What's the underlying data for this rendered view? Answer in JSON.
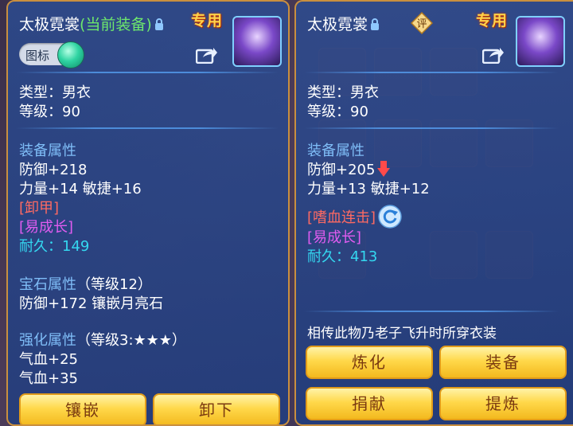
{
  "left": {
    "title": "太极霓裳",
    "equipped_tag": "(当前装备)",
    "exclusive": "专用",
    "toggle_label": "图标",
    "type_line": "类型：男衣",
    "level_line": "等级：90",
    "equip_attr_header": "装备属性",
    "defense": "防御+218",
    "stats": "力量+14 敏捷+16",
    "special_1": "[卸甲]",
    "special_2": "[易成长]",
    "durability_label": "耐久：",
    "durability_value": "149",
    "gem_header": "宝石属性",
    "gem_level": "（等级12）",
    "gem_line": "防御+172 镶嵌月亮石",
    "enhance_header": "强化属性",
    "enhance_level": "（等级3:★★★）",
    "enhance_1": "气血+25",
    "enhance_2": "气血+35",
    "buttons": {
      "inlay": "镶嵌",
      "unequip": "卸下"
    }
  },
  "right": {
    "title": "太极霓裳",
    "exclusive": "专用",
    "seal_char": "评",
    "type_line": "类型：男衣",
    "level_line": "等级：90",
    "equip_attr_header": "装备属性",
    "defense": "防御+205",
    "stats": "力量+13 敏捷+12",
    "special_1": "[嗜血连击]",
    "special_2": "[易成长]",
    "durability_label": "耐久：",
    "durability_value": "413",
    "description": "相传此物乃老子飞升时所穿衣装",
    "buttons": {
      "refine": "炼化",
      "equip": "装备",
      "donate": "捐献",
      "extract": "提炼"
    }
  },
  "colors": {
    "panel": "#2a4e96",
    "border": "#c98f3f",
    "button": "#ffd84a",
    "attr_header": "#7fbdf7",
    "special": "#e05cf0",
    "durability": "#34d8f0",
    "equipped": "#6de86d",
    "decrease": "#ff6a62"
  },
  "icons": [
    "lock-icon",
    "share-icon",
    "down-arrow-icon",
    "refresh-icon",
    "appraisal-seal-icon",
    "item-avatar-icon"
  ]
}
